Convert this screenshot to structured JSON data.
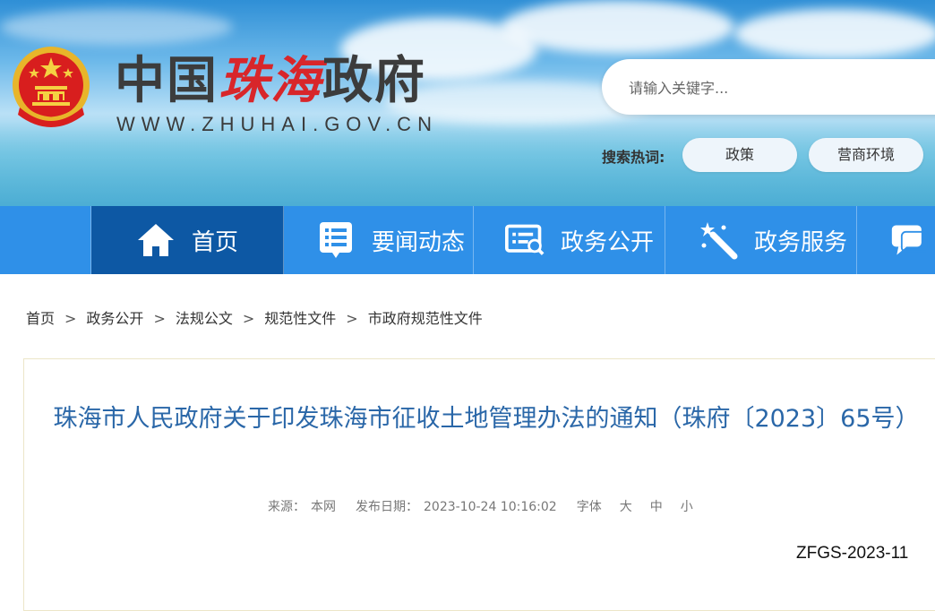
{
  "header": {
    "logo_part1": "中国",
    "logo_part2": "珠海",
    "logo_part3": "政府",
    "logo_url": "WWW.ZHUHAI.GOV.CN",
    "search_placeholder": "请输入关键字...",
    "hot_label": "搜索热词:",
    "hot_words": [
      "政策",
      "营商环境"
    ]
  },
  "nav": {
    "items": [
      {
        "label": "首页",
        "icon": "home-icon"
      },
      {
        "label": "要闻动态",
        "icon": "news-list-icon"
      },
      {
        "label": "政务公开",
        "icon": "announcement-icon"
      },
      {
        "label": "政务服务",
        "icon": "magic-wand-icon"
      },
      {
        "label": "",
        "icon": "chat-bubble-icon"
      }
    ]
  },
  "breadcrumb": {
    "items": [
      "首页",
      "政务公开",
      "法规公文",
      "规范性文件",
      "市政府规范性文件"
    ],
    "separator": ">"
  },
  "article": {
    "title": "珠海市人民政府关于印发珠海市征收土地管理办法的通知（珠府〔2023〕65号）",
    "source_label": "来源：",
    "source_value": "本网",
    "date_label": "发布日期：",
    "date_value": "2023-10-24 10:16:02",
    "font_label": "字体",
    "font_sizes": [
      "大",
      "中",
      "小"
    ],
    "doc_number": "ZFGS-2023-11"
  },
  "colors": {
    "nav_bg": "#2f90e8",
    "nav_active": "#0d58a4",
    "title": "#2a67a8",
    "logo_red": "#d8262a"
  }
}
